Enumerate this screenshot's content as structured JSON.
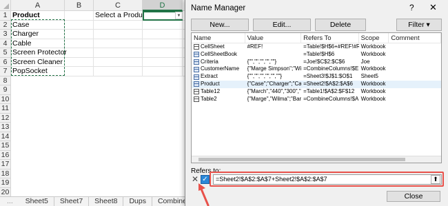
{
  "spreadsheet": {
    "columns": [
      "A",
      "B",
      "C",
      "D"
    ],
    "rows": [
      "1",
      "2",
      "3",
      "4",
      "5",
      "6",
      "7",
      "8",
      "9",
      "10",
      "11",
      "12",
      "13",
      "14",
      "15",
      "16",
      "17",
      "18",
      "19",
      "20"
    ],
    "cells": {
      "a1": "Product",
      "a2": "Case",
      "a3": "Charger",
      "a4": "Cable",
      "a5": "Screen Protector",
      "a6": "Screen Cleaner",
      "a7": "PopSocket",
      "c1": "Select a Product:"
    },
    "selected_column": "D",
    "dropdown_icon": "caret-down-icon",
    "tabs": [
      "Sheet5",
      "Sheet7",
      "Sheet8",
      "Dups",
      "Combine"
    ],
    "tab_nav": "..."
  },
  "dialog": {
    "title": "Name Manager",
    "help": "?",
    "close_glyph": "✕",
    "buttons": {
      "new": "New...",
      "edit": "Edit...",
      "delete": "Delete",
      "filter": "Filter ▾"
    },
    "columns": [
      "Name",
      "Value",
      "Refers To",
      "Scope",
      "Comment"
    ],
    "rows": [
      {
        "name": "CellSheet",
        "value": "#REF!",
        "refers": "=Table!$H$6+#REF!#REF!",
        "scope": "Workbook",
        "icon": "table-icon"
      },
      {
        "name": "CellSheetBook",
        "value": "",
        "refers": "=Table!$H$6",
        "scope": "Workbook",
        "icon": "range-icon"
      },
      {
        "name": "Criteria",
        "value": "{\"\",\"\",\"\",\"\",\"\"}",
        "refers": "=Joe!$C$2:$C$6",
        "scope": "Joe",
        "icon": "range-icon"
      },
      {
        "name": "CustomerName",
        "value": "{\"Marge Simpson\";\"Wi...",
        "refers": "=CombineColumns!$E...",
        "scope": "Workbook",
        "icon": "range-icon"
      },
      {
        "name": "Extract",
        "value": "{\"\",\"\",\"\",\"\",\"\",\"\"}",
        "refers": "=Sheet3!$J$1:$O$1",
        "scope": "Sheet5",
        "icon": "range-icon"
      },
      {
        "name": "Product",
        "value": "{\"Case\";\"Charger\";\"Ca...",
        "refers": "=Sheet2!$A$2:$A$6",
        "scope": "Workbook",
        "icon": "range-icon"
      },
      {
        "name": "Table12",
        "value": "{\"March\",\"440\",\"300\",\"...",
        "refers": "=Table1!$A$2:$F$12",
        "scope": "Workbook",
        "icon": "table-icon"
      },
      {
        "name": "Table2",
        "value": "{\"Marge\",\"Wilma\";\"Bar...",
        "refers": "=CombineColumns!$A...",
        "scope": "Workbook",
        "icon": "table-icon"
      }
    ],
    "selected_row": 5,
    "refers_to_label": "Refers to:",
    "refers_to_value": "=Sheet2!$A$2:$A$7+Sheet2!$A$2:$A$7",
    "cancel_glyph": "✕",
    "confirm_glyph": "✓",
    "collapse_glyph": "⬆",
    "close_label": "Close"
  },
  "colors": {
    "excel_green": "#217346",
    "highlight": "#e8514a",
    "accent_blue": "#2b88d8"
  }
}
